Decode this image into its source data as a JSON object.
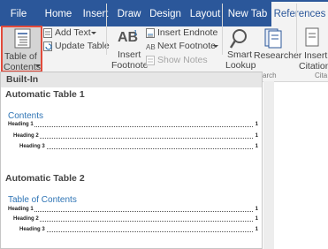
{
  "tabs": [
    {
      "label": "File",
      "active": false
    },
    {
      "label": "Home",
      "active": false
    },
    {
      "label": "Insert",
      "active": false
    },
    {
      "label": "Draw",
      "active": false
    },
    {
      "label": "Design",
      "active": false
    },
    {
      "label": "Layout",
      "active": false
    },
    {
      "label": "New Tab",
      "active": false
    },
    {
      "label": "References",
      "active": true
    }
  ],
  "ribbon": {
    "toc": {
      "line1": "Table of",
      "line2": "Contents"
    },
    "add_text": "Add Text",
    "update_table": "Update Table",
    "insert_footnote": {
      "line1": "Insert",
      "line2": "Footnote",
      "icon_text": "AB"
    },
    "insert_endnote": "Insert Endnote",
    "next_footnote": "Next Footnote",
    "show_notes": "Show Notes",
    "smart_lookup": {
      "line1": "Smart",
      "line2": "Lookup"
    },
    "researcher": "Researcher",
    "insert_citation": {
      "line1": "Insert",
      "line2": "Citation"
    },
    "group_search_partial": "arch",
    "group_citations_partial": "Cita"
  },
  "gallery": {
    "section_header": "Built-In",
    "tables": [
      {
        "name": "Automatic Table 1",
        "heading": "Contents",
        "entries": [
          {
            "text": "Heading 1",
            "page": "1"
          },
          {
            "text": "Heading 2",
            "page": "1"
          },
          {
            "text": "Heading 3",
            "page": "1"
          }
        ]
      },
      {
        "name": "Automatic Table 2",
        "heading": "Table of Contents",
        "entries": [
          {
            "text": "Heading 1",
            "page": "1"
          },
          {
            "text": "Heading 2",
            "page": "1"
          },
          {
            "text": "Heading 3",
            "page": "1"
          }
        ]
      }
    ]
  },
  "colors": {
    "tab_bar": "#2b579a",
    "highlight": "#e24a3b",
    "toc_heading": "#2e74b5"
  }
}
